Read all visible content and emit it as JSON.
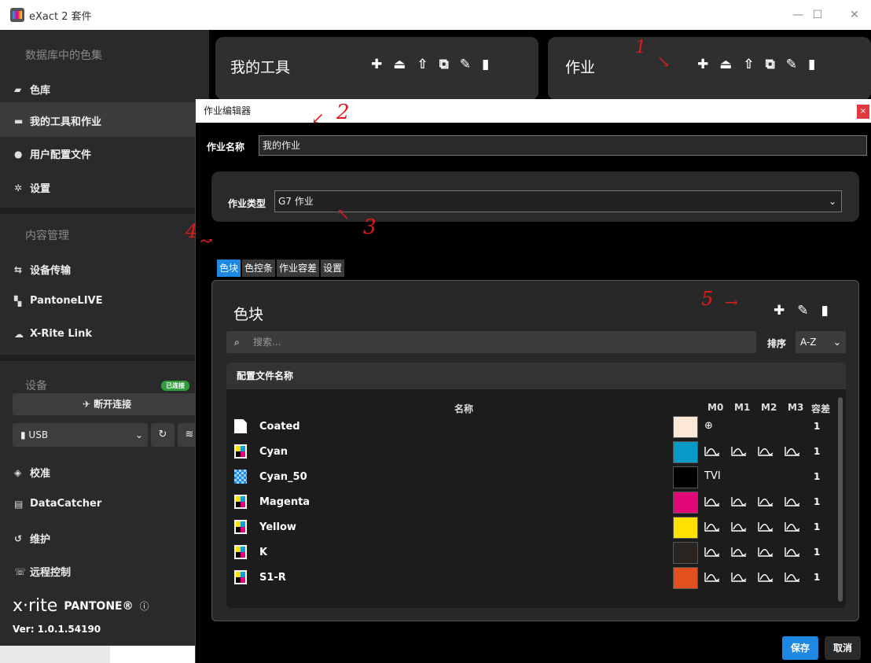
{
  "window": {
    "title": "eXact 2 套件",
    "min": "—",
    "max": "☐",
    "close": "✕"
  },
  "sidebar": {
    "section_color_sets": "数据库中的色集",
    "items": [
      {
        "label": "色库"
      },
      {
        "label": "我的工具和作业"
      },
      {
        "label": "用户配置文件"
      },
      {
        "label": "设置"
      }
    ],
    "section_content": "内容管理",
    "content_items": [
      {
        "label": "设备传输"
      },
      {
        "label": "PantoneLIVE"
      },
      {
        "label": "X-Rite Link"
      }
    ],
    "section_device": "设备",
    "connected_badge": "已连接",
    "disconnect_label": "断开连接",
    "usb_value": "USB",
    "device_items": [
      {
        "label": "校准"
      },
      {
        "label": "DataCatcher"
      },
      {
        "label": "维护"
      },
      {
        "label": "远程控制"
      }
    ],
    "brand_xrite": "x·rite",
    "brand_pantone": "PANTONE®",
    "version": "Ver: 1.0.1.54190"
  },
  "cards": {
    "tools_title": "我的工具",
    "jobs_title": "作业"
  },
  "dialog": {
    "title": "作业编辑器",
    "close": "×",
    "job_name_label": "作业名称",
    "job_name_value": "我的作业",
    "job_type_label": "作业类型",
    "job_type_value": "G7 作业",
    "tabs": [
      "色块",
      "色控条",
      "作业容差",
      "设置"
    ],
    "panel_title": "色块",
    "search_placeholder": "搜索...",
    "sort_label": "排序",
    "sort_value": "A-Z",
    "table_title": "配置文件名称",
    "columns": {
      "name": "名称",
      "m0": "M0",
      "m1": "M1",
      "m2": "M2",
      "m3": "M3",
      "tol": "容差"
    },
    "rows": [
      {
        "name": "Coated",
        "swatch": "#fde7d6",
        "m0": "globe",
        "tvi": "",
        "curves": false,
        "tol": "1",
        "icon": "doc"
      },
      {
        "name": "Cyan",
        "swatch": "#069ac8",
        "m0": "",
        "tvi": "",
        "curves": true,
        "tol": "1",
        "icon": "cmyk"
      },
      {
        "name": "Cyan_50",
        "swatch": "#000000",
        "m0": "",
        "tvi": "TVI",
        "curves": false,
        "tol": "1",
        "icon": "check"
      },
      {
        "name": "Magenta",
        "swatch": "#e2087a",
        "m0": "",
        "tvi": "",
        "curves": true,
        "tol": "1",
        "icon": "cmyk"
      },
      {
        "name": "Yellow",
        "swatch": "#fde100",
        "m0": "",
        "tvi": "",
        "curves": true,
        "tol": "1",
        "icon": "cmyk"
      },
      {
        "name": "K",
        "swatch": "#2a2420",
        "m0": "",
        "tvi": "",
        "curves": true,
        "tol": "1",
        "icon": "cmyk"
      },
      {
        "name": "S1-R",
        "swatch": "#e2501f",
        "m0": "",
        "tvi": "",
        "curves": true,
        "tol": "1",
        "icon": "cmyk"
      }
    ],
    "save_label": "保存",
    "cancel_label": "取消"
  },
  "annotations": {
    "a1": "1",
    "a2": "2",
    "a3": "3",
    "a4": "4",
    "a5": "5"
  }
}
